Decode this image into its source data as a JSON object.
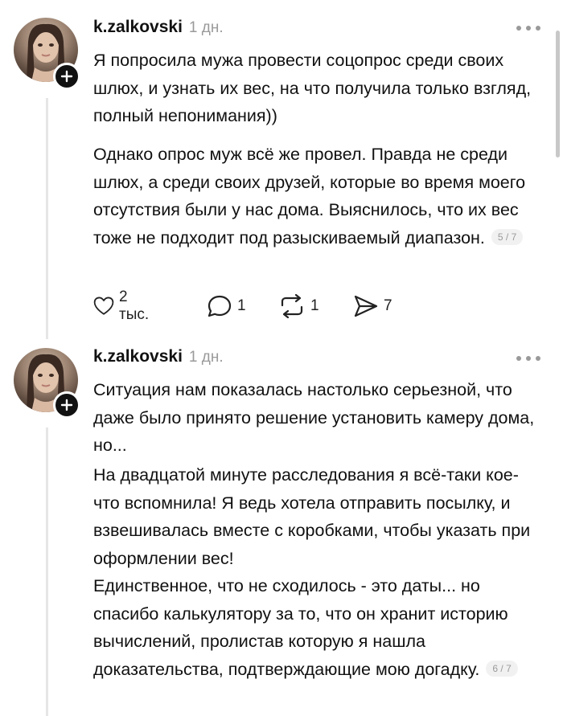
{
  "posts": [
    {
      "username": "k.zalkovski",
      "time": "1 дн.",
      "paragraphs": [
        "Я попросила мужа провести соцопрос среди своих шлюх, и узнать их вес, на что получила только взгляд, полный непонимания))",
        "Однако опрос муж всё же провел. Правда не среди шлюх, а среди своих друзей, которые во время моего отсутствия были у нас дома. Выяснилось, что их вес тоже не подходит под разыскиваемый диапазон."
      ],
      "counter": "5 / 7",
      "actions": {
        "likes": "2 тыс.",
        "comments": "1",
        "reposts": "1",
        "shares": "7"
      }
    },
    {
      "username": "k.zalkovski",
      "time": "1 дн.",
      "paragraphs": [
        "Ситуация нам показалась настолько серьезной, что даже было принято решение установить камеру дома, но...",
        "На двадцатой минуте расследования я всё-таки кое-что вспомнила! Я ведь хотела отправить посылку, и взвешивалась вместе с коробками, чтобы указать при оформлении вес!",
        "Единственное, что не сходилось - это даты... но спасибо калькулятору за то, что он хранит историю вычислений, пролистав которую я нашла доказательства, подтверждающие мою догадку."
      ],
      "counter": "6 / 7"
    }
  ],
  "icons": {
    "like": "heart-icon",
    "comment": "comment-icon",
    "repost": "repost-icon",
    "share": "send-icon",
    "follow": "plus-icon",
    "more": "more-icon"
  }
}
